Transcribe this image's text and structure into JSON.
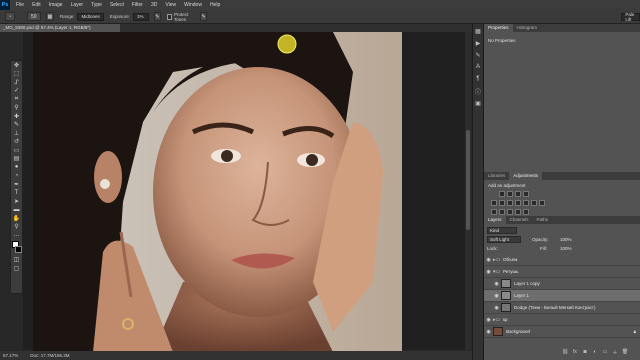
{
  "app_logo": "Ps",
  "menu": [
    "File",
    "Edit",
    "Image",
    "Layer",
    "Type",
    "Select",
    "Filter",
    "3D",
    "View",
    "Window",
    "Help"
  ],
  "options": {
    "brush_size": "50",
    "range_label": "Range:",
    "range_value": "Midtones",
    "exposure_label": "Exposure:",
    "exposure_value": "1%",
    "protect_tones": "Protect Tones",
    "workspace": "Pale Lift"
  },
  "document_tab": "_MG_9380.psd @ 57.4% (Layer 1, RGB/8*)",
  "tools": [
    "move-icon",
    "marquee-icon",
    "lasso-icon",
    "quick-select-icon",
    "crop-icon",
    "eyedropper-icon",
    "healing-icon",
    "brush-icon",
    "clone-stamp-icon",
    "history-brush-icon",
    "eraser-icon",
    "gradient-icon",
    "blur-icon",
    "dodge-icon",
    "pen-icon",
    "type-icon",
    "path-select-icon",
    "shape-icon",
    "hand-icon",
    "zoom-icon",
    "more-icon",
    "colors-icon",
    "swap-icon",
    "quickmask-icon",
    "screenmode-icon"
  ],
  "status": {
    "zoom": "57.17%",
    "doc": "Doc: 17.7M/186.3M"
  },
  "properties": {
    "tabs": [
      "Properties",
      "Histogram"
    ],
    "message": "No Properties"
  },
  "adjustments": {
    "tabs": [
      "Libraries",
      "Adjustments"
    ],
    "title": "Add an adjustment"
  },
  "layers": {
    "tabs": [
      "Layers",
      "Channels",
      "Paths"
    ],
    "kind": "Kind",
    "blend_mode": "Soft Light",
    "opacity_label": "Opacity:",
    "opacity_value": "100%",
    "lock_label": "Lock:",
    "fill_label": "Fill:",
    "fill_value": "100%",
    "rows": [
      {
        "name": "Объем",
        "kind": "group"
      },
      {
        "name": "Ретушь",
        "kind": "group"
      },
      {
        "name": "Layer 1 copy",
        "kind": "layer"
      },
      {
        "name": "Layer 1",
        "kind": "layer"
      },
      {
        "name": "Dodge (Тени - Белый Мягкий Контраст)",
        "kind": "layer"
      },
      {
        "name": "кр",
        "kind": "group"
      },
      {
        "name": "Background",
        "kind": "background"
      }
    ]
  },
  "colors": {
    "accent": "#31a8ff",
    "panel": "#535353",
    "selected_row": "#6e6e6e",
    "cursor": "#e0d02a"
  }
}
